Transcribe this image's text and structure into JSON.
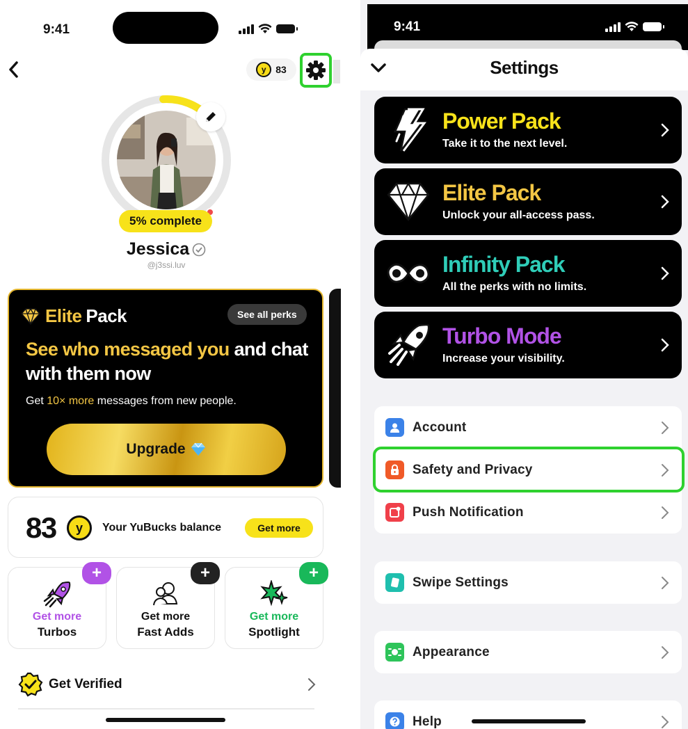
{
  "left_screen": {
    "status_time": "9:41",
    "coins_count": "83",
    "profile": {
      "completion": "5% complete",
      "completion_fraction": 0.05,
      "name": "Jessica",
      "handle": "@j3ssi.luv"
    },
    "elite_card": {
      "title_word1": "Elite",
      "title_word2": "Pack",
      "see_perks": "See all perks",
      "headline_highlight": "See who messaged you",
      "headline_rest": "and chat with them now",
      "sub_prefix": "Get",
      "sub_highlight": "10× more",
      "sub_suffix": "messages from new people.",
      "upgrade_label": "Upgrade"
    },
    "yubucks": {
      "amount": "83",
      "coin_letter": "y",
      "label": "Your YuBucks balance",
      "get_more": "Get more"
    },
    "tiles": [
      {
        "line1": "Get more",
        "line2": "Turbos",
        "accent": "#b152e6",
        "icon": "rocket-icon"
      },
      {
        "line1": "Get more",
        "line2": "Fast Adds",
        "accent": "#222222",
        "icon": "fast-adds-icon"
      },
      {
        "line1": "Get more",
        "line2": "Spotlight",
        "accent": "#19b85a",
        "icon": "spotlight-icon"
      }
    ],
    "tile_plus": "+",
    "verified_label": "Get Verified"
  },
  "right_screen": {
    "status_time": "9:41",
    "title": "Settings",
    "packs": [
      {
        "title": "Power Pack",
        "subtitle": "Take it to the next level.",
        "color": "#f7e21a",
        "icon": "lightning-icon"
      },
      {
        "title": "Elite Pack",
        "subtitle": "Unlock your all-access pass.",
        "color": "#f3c644",
        "icon": "diamond-icon"
      },
      {
        "title": "Infinity Pack",
        "subtitle": "All the perks with no limits.",
        "color": "#2fcdb8",
        "icon": "infinity-icon"
      },
      {
        "title": "Turbo Mode",
        "subtitle": "Increase your visibility.",
        "color": "#b152e6",
        "icon": "rocket-icon"
      }
    ],
    "settings": [
      {
        "label": "Account",
        "color": "#3b82e8",
        "icon": "person-icon"
      },
      {
        "label": "Safety and Privacy",
        "color": "#f05a28",
        "icon": "lock-icon"
      },
      {
        "label": "Push Notification",
        "color": "#f0404a",
        "icon": "notification-icon"
      },
      {
        "label": "Swipe Settings",
        "color": "#1fbfae",
        "icon": "cards-icon"
      },
      {
        "label": "Appearance",
        "color": "#2ec45a",
        "icon": "appearance-icon"
      },
      {
        "label": "Help",
        "color": "#3b82e8",
        "icon": "help-icon"
      }
    ]
  },
  "colors": {
    "highlight": "#2fd12f",
    "yellow": "#f7e21a",
    "gold": "#f3c644"
  }
}
